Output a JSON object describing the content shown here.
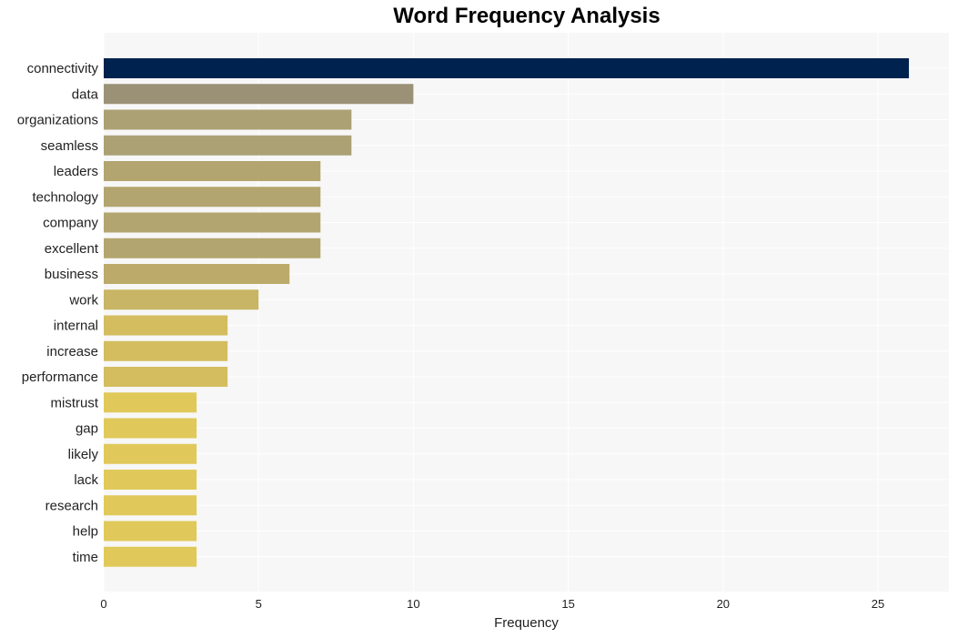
{
  "chart_data": {
    "type": "bar",
    "orientation": "horizontal",
    "title": "Word Frequency Analysis",
    "xlabel": "Frequency",
    "ylabel": "",
    "xlim": [
      0,
      27.3
    ],
    "xticks": [
      0,
      5,
      10,
      15,
      20,
      25
    ],
    "grid": true,
    "legend": "none",
    "categories": [
      "connectivity",
      "data",
      "organizations",
      "seamless",
      "leaders",
      "technology",
      "company",
      "excellent",
      "business",
      "work",
      "internal",
      "increase",
      "performance",
      "mistrust",
      "gap",
      "likely",
      "lack",
      "research",
      "help",
      "time"
    ],
    "values": [
      26,
      10,
      8,
      8,
      7,
      7,
      7,
      7,
      6,
      5,
      4,
      4,
      4,
      3,
      3,
      3,
      3,
      3,
      3,
      3
    ],
    "colors": [
      "#00224e",
      "#9a9177",
      "#aca174",
      "#aca174",
      "#b3a56f",
      "#b3a56f",
      "#b3a56f",
      "#b3a56f",
      "#bcaa6b",
      "#c8b565",
      "#d3bd5f",
      "#d3bd5f",
      "#d3bd5f",
      "#e0c95a",
      "#e0c95a",
      "#e0c95a",
      "#e0c95a",
      "#e0c95a",
      "#e0c95a",
      "#e0c95a"
    ],
    "background": "#f7f7f7"
  }
}
